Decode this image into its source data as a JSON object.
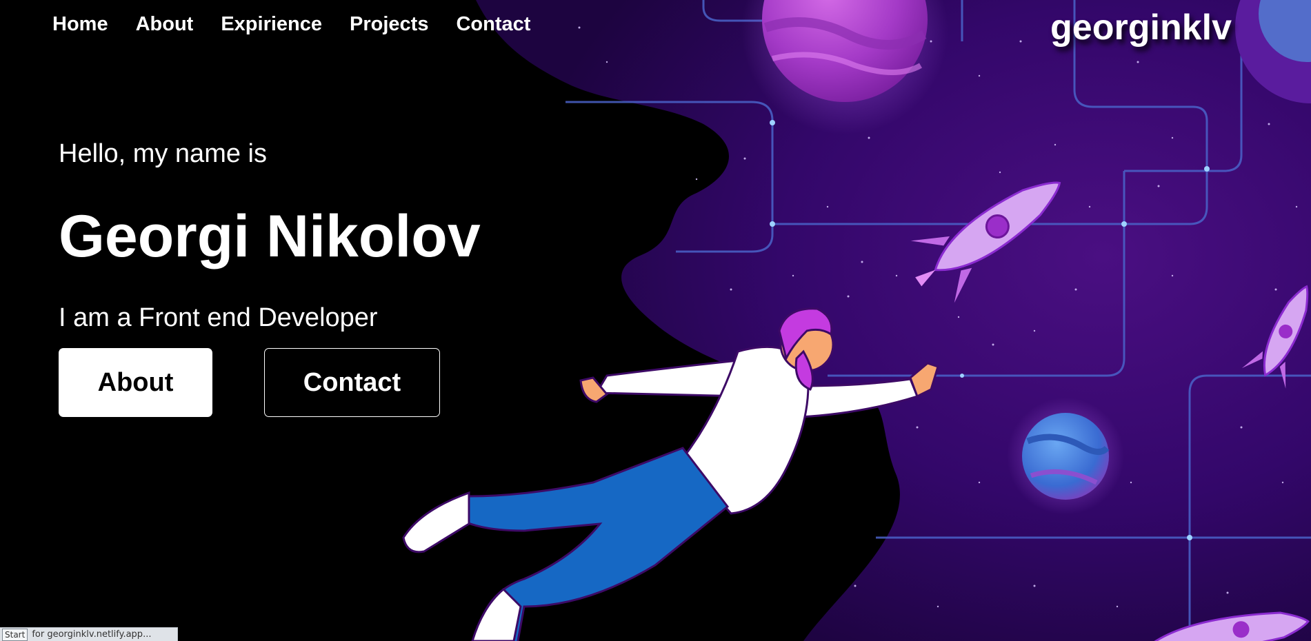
{
  "nav": {
    "items": [
      {
        "label": "Home"
      },
      {
        "label": "About"
      },
      {
        "label": "Expirience"
      },
      {
        "label": "Projects"
      },
      {
        "label": "Contact"
      }
    ]
  },
  "brand": {
    "label": "georginklv"
  },
  "hero": {
    "greeting": "Hello, my name is",
    "name": "Georgi Nikolov",
    "tagline": "I am a Front end Developer",
    "primary_button": "About",
    "secondary_button": "Contact"
  },
  "status_bar": {
    "start_label": "Start",
    "text": "for georginklv.netlify.app..."
  },
  "colors": {
    "background": "#000000",
    "space_purple": "#3a0a6b",
    "accent_magenta": "#c43be0",
    "jeans_blue": "#1668c4",
    "circuit_blue": "#4a63c9"
  },
  "icons": [
    "astronaut-illustration",
    "rocket-icon",
    "planet-icon"
  ]
}
